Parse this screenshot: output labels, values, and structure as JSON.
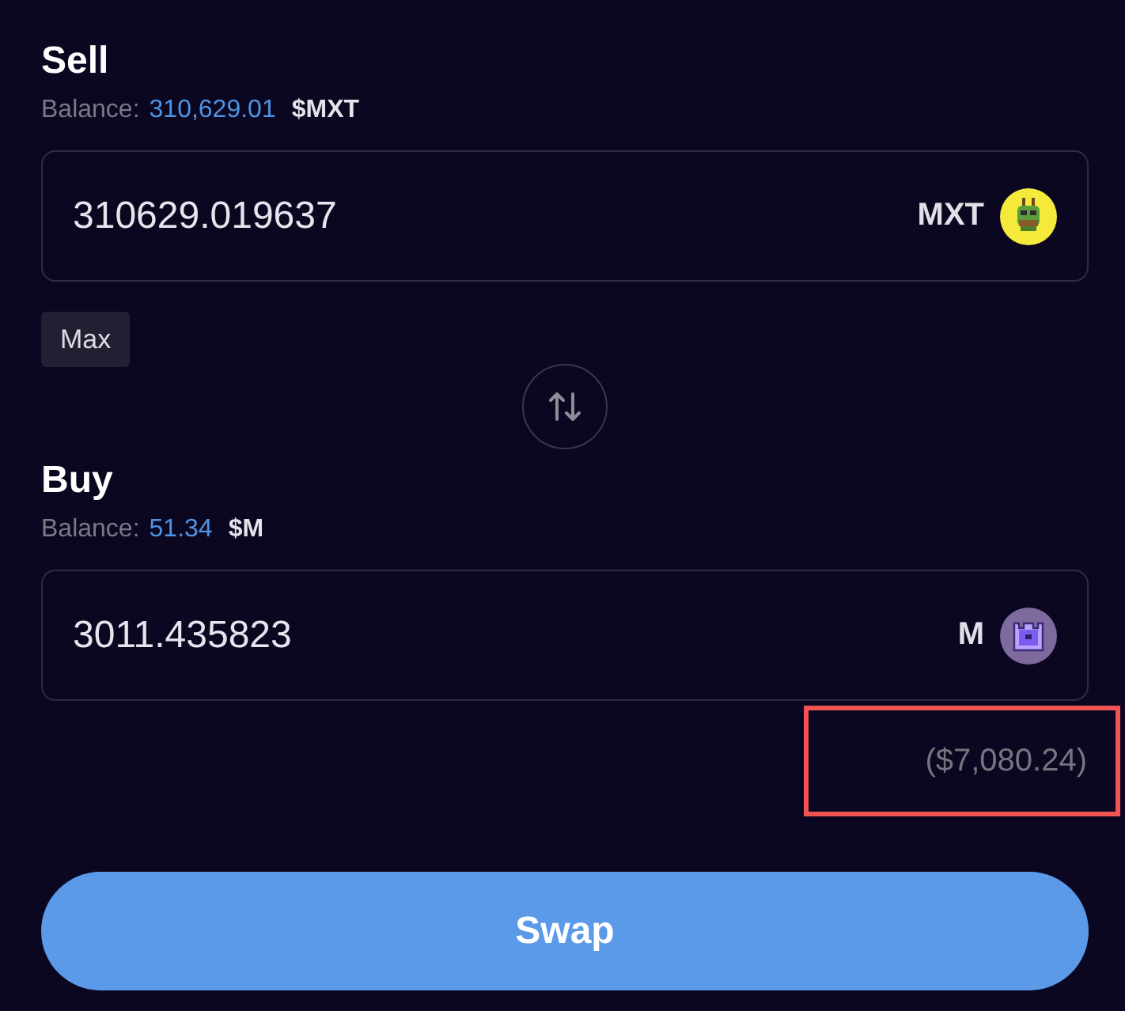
{
  "panels": [
    {
      "kind": "sell",
      "title": "Sell",
      "balance_label": "Balance:",
      "balance_value": "310,629.01",
      "balance_token": "$MXT",
      "amount": "310629.019637",
      "token": "MXT",
      "color": "#f5ea3c",
      "max_button": "Max"
    },
    {
      "kind": "buy",
      "title": "Buy",
      "balance_label": "Balance:",
      "balance_value": "51.34",
      "balance_token": "$M",
      "amount": "3011.435823",
      "token": "M",
      "color": "#7e6a9c",
      "usd_value": "($7,080.24)",
      "highlighted": true
    }
  ],
  "swap_button": "Swap"
}
